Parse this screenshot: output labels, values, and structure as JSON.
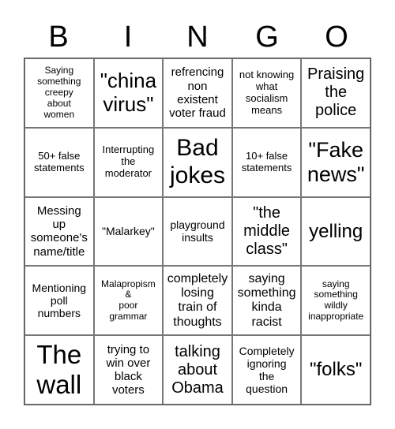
{
  "header": [
    "B",
    "I",
    "N",
    "G",
    "O"
  ],
  "cells": [
    "Saying\nsomething\ncreepy\nabout\nwomen",
    "\"china\nvirus\"",
    "refrencing\nnon\nexistent\nvoter fraud",
    "not knowing\nwhat\nsocialism\nmeans",
    "Praising\nthe\npolice",
    "50+ false\nstatements",
    "Interrupting\nthe\nmoderator",
    "Bad\njokes",
    "10+ false\nstatements",
    "\"Fake\nnews\"",
    "Messing\nup\nsomeone's\nname/title",
    "\"Malarkey\"",
    "playground\ninsults",
    "\"the\nmiddle\nclass\"",
    "yelling",
    "Mentioning\npoll\nnumbers",
    "Malapropism\n&\npoor\ngrammar",
    "completely\nlosing\ntrain of\nthoughts",
    "saying\nsomething\nkinda\nracist",
    "saying\nsomething\nwildly\ninappropriate",
    "The\nwall",
    "trying to\nwin over\nblack\nvoters",
    "talking\nabout\nObama",
    "Completely\nignoring\nthe\nquestion",
    "\"folks\""
  ]
}
